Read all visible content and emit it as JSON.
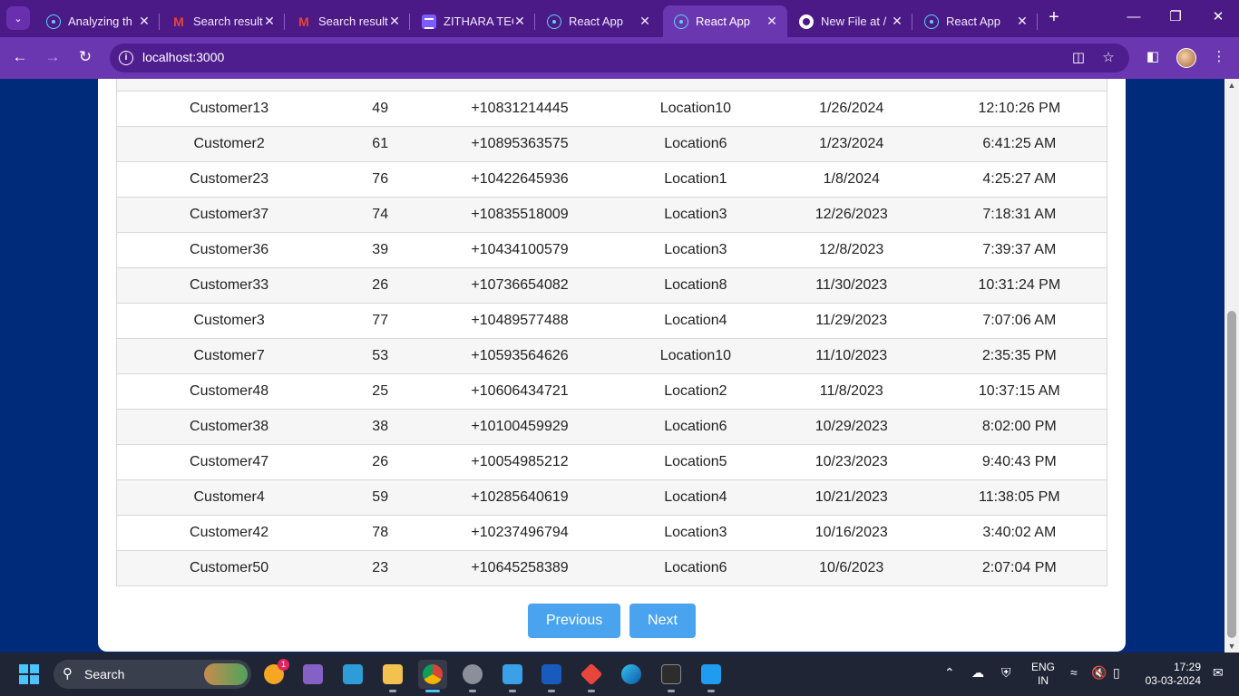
{
  "browser": {
    "tabs": [
      {
        "title": "Analyzing th",
        "favicon": "react-icon",
        "active": false
      },
      {
        "title": "Search result",
        "favicon": "gmail-icon",
        "active": false
      },
      {
        "title": "Search result",
        "favicon": "gmail-icon",
        "active": false
      },
      {
        "title": "ZITHARA TEC",
        "favicon": "list-icon",
        "active": false
      },
      {
        "title": "React App",
        "favicon": "react-icon",
        "active": false
      },
      {
        "title": "React App",
        "favicon": "react-icon",
        "active": true
      },
      {
        "title": "New File at /",
        "favicon": "github-icon",
        "active": false
      },
      {
        "title": "React App",
        "favicon": "react-icon",
        "active": false
      }
    ],
    "url": "localhost:3000"
  },
  "table": {
    "rows": [
      [
        "",
        "",
        "",
        "",
        "",
        ""
      ],
      [
        "Customer13",
        "49",
        "+10831214445",
        "Location10",
        "1/26/2024",
        "12:10:26 PM"
      ],
      [
        "Customer2",
        "61",
        "+10895363575",
        "Location6",
        "1/23/2024",
        "6:41:25 AM"
      ],
      [
        "Customer23",
        "76",
        "+10422645936",
        "Location1",
        "1/8/2024",
        "4:25:27 AM"
      ],
      [
        "Customer37",
        "74",
        "+10835518009",
        "Location3",
        "12/26/2023",
        "7:18:31 AM"
      ],
      [
        "Customer36",
        "39",
        "+10434100579",
        "Location3",
        "12/8/2023",
        "7:39:37 AM"
      ],
      [
        "Customer33",
        "26",
        "+10736654082",
        "Location8",
        "11/30/2023",
        "10:31:24 PM"
      ],
      [
        "Customer3",
        "77",
        "+10489577488",
        "Location4",
        "11/29/2023",
        "7:07:06 AM"
      ],
      [
        "Customer7",
        "53",
        "+10593564626",
        "Location10",
        "11/10/2023",
        "2:35:35 PM"
      ],
      [
        "Customer48",
        "25",
        "+10606434721",
        "Location2",
        "11/8/2023",
        "10:37:15 AM"
      ],
      [
        "Customer38",
        "38",
        "+10100459929",
        "Location6",
        "10/29/2023",
        "8:02:00 PM"
      ],
      [
        "Customer47",
        "26",
        "+10054985212",
        "Location5",
        "10/23/2023",
        "9:40:43 PM"
      ],
      [
        "Customer4",
        "59",
        "+10285640619",
        "Location4",
        "10/21/2023",
        "11:38:05 PM"
      ],
      [
        "Customer42",
        "78",
        "+10237496794",
        "Location3",
        "10/16/2023",
        "3:40:02 AM"
      ],
      [
        "Customer50",
        "23",
        "+10645258389",
        "Location6",
        "10/6/2023",
        "2:07:04 PM"
      ]
    ]
  },
  "pagination": {
    "previous_label": "Previous",
    "next_label": "Next"
  },
  "taskbar": {
    "search_label": "Search",
    "notification_badge": "1",
    "language": "ENG",
    "region": "IN",
    "time": "17:29",
    "date": "03-03-2024"
  },
  "colors": {
    "tab_bar": "#4b1a86",
    "address_bar": "#6b37b1",
    "page_background": "#002a7a",
    "button": "#4aa3ee",
    "taskbar": "#1f2535"
  }
}
